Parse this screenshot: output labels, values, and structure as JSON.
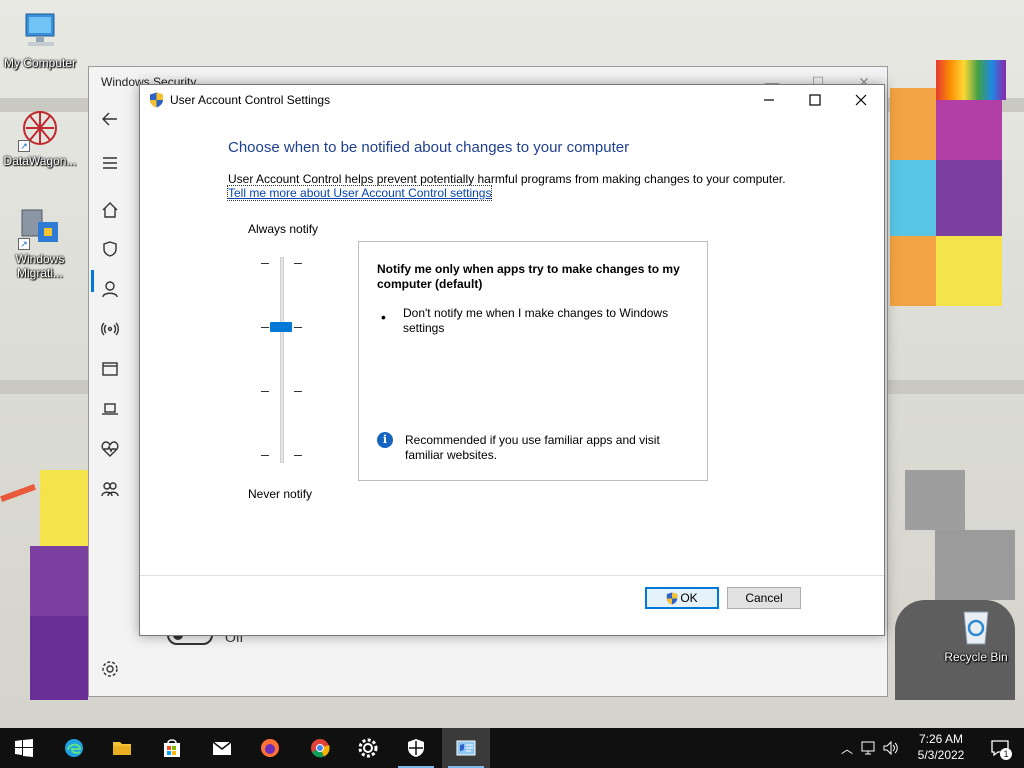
{
  "desktop": {
    "icons": [
      {
        "label": "My Computer",
        "icon": "computer-icon"
      },
      {
        "label": "DataWagon...",
        "icon": "datawagon-icon"
      },
      {
        "label": "Windows Migrati...",
        "icon": "windows-migration-icon"
      },
      {
        "label": "Recycle Bin",
        "icon": "recycle-bin-icon"
      }
    ]
  },
  "windows_security": {
    "title": "Windows Security",
    "toggle_label": "Off"
  },
  "uac": {
    "title": "User Account Control Settings",
    "heading": "Choose when to be notified about changes to your computer",
    "description": "User Account Control helps prevent potentially harmful programs from making changes to your computer.",
    "link": "Tell me more about User Account Control settings",
    "slider": {
      "top_label": "Always notify",
      "bottom_label": "Never notify",
      "levels": 4,
      "selected_level": 3
    },
    "info": {
      "title": "Notify me only when apps try to make changes to my computer (default)",
      "bullet": "Don't notify me when I make changes to Windows settings",
      "recommendation": "Recommended if you use familiar apps and visit familiar websites."
    },
    "ok_label": "OK",
    "cancel_label": "Cancel"
  },
  "taskbar": {
    "time": "7:26 AM",
    "date": "5/3/2022",
    "notification_count": "1"
  },
  "colors": {
    "accent": "#0078d7",
    "heading": "#1f3f8f",
    "taskbar": "#101010"
  }
}
